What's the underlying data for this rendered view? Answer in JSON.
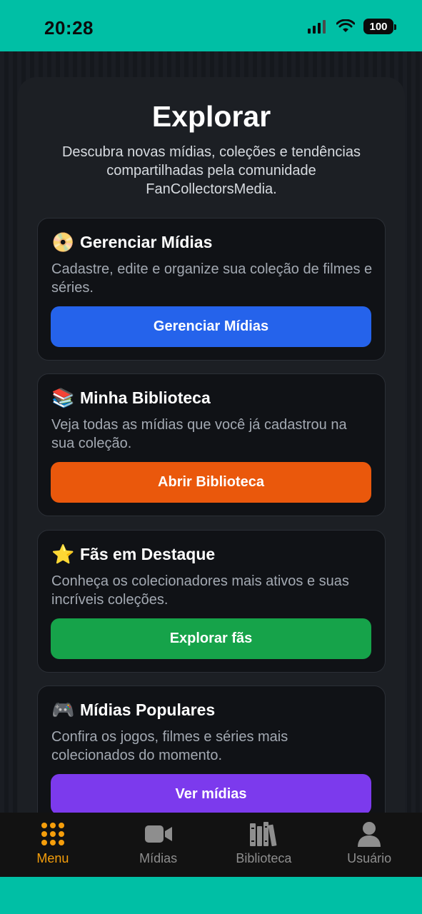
{
  "status_bar": {
    "time": "20:28",
    "battery": "100",
    "icons": [
      "signal-icon",
      "wifi-icon",
      "battery-icon"
    ]
  },
  "page": {
    "title": "Explorar",
    "subtitle": "Descubra novas mídias, coleções e tendências compartilhadas pela comunidade FanCollectorsMedia."
  },
  "cards": [
    {
      "emoji": "📀",
      "title": "Gerenciar Mídias",
      "description": "Cadastre, edite e organize sua coleção de filmes e séries.",
      "button": "Gerenciar Mídias",
      "color": "#2563eb"
    },
    {
      "emoji": "📚",
      "title": "Minha Biblioteca",
      "description": "Veja todas as mídias que você já cadastrou na sua coleção.",
      "button": "Abrir Biblioteca",
      "color": "#ea580c"
    },
    {
      "emoji": "⭐",
      "title": "Fãs em Destaque",
      "description": "Conheça os colecionadores mais ativos e suas incríveis coleções.",
      "button": "Explorar fãs",
      "color": "#16a34a"
    },
    {
      "emoji": "🎮",
      "title": "Mídias Populares",
      "description": "Confira os jogos, filmes e séries mais colecionados do momento.",
      "button": "Ver mídias",
      "color": "#7c3aed"
    }
  ],
  "tabs": [
    {
      "label": "Menu",
      "icon": "grid-icon",
      "active": true
    },
    {
      "label": "Mídias",
      "icon": "video-camera-icon",
      "active": false
    },
    {
      "label": "Biblioteca",
      "icon": "books-icon",
      "active": false
    },
    {
      "label": "Usuário",
      "icon": "user-icon",
      "active": false
    }
  ],
  "colors": {
    "accent_active_tab": "#f59e0b",
    "status_bar": "#00bfa5"
  }
}
